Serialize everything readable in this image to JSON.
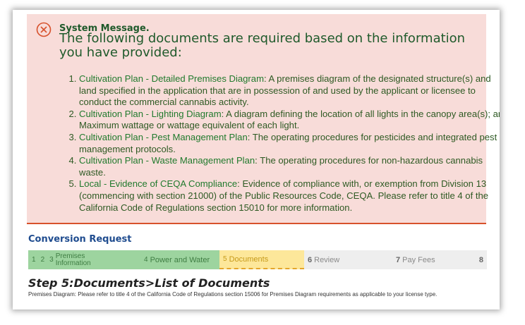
{
  "message": {
    "label": "System Message.",
    "headline": "The following documents are required based on the information you have provided:",
    "documents": [
      {
        "number": "1.",
        "title": "Cultivation Plan - Detailed Premises Diagram",
        "description": ": A premises diagram of the designated structure(s) and land specified in the application that are in possession of and used by the applicant or licensee to conduct the commercial cannabis activity."
      },
      {
        "number": "2.",
        "title": "Cultivation Plan - Lighting Diagram",
        "description": ": A diagram defining the location of all lights in the canopy area(s); and Maximum wattage or wattage equivalent of each light."
      },
      {
        "number": "3.",
        "title": "Cultivation Plan - Pest Management Plan",
        "description": ": The operating procedures for pesticides and integrated pest management protocols."
      },
      {
        "number": "4.",
        "title": "Cultivation Plan - Waste Management Plan",
        "description": ": The operating procedures for non-hazardous cannabis waste."
      },
      {
        "number": "5.",
        "title": "Local - Evidence of CEQA Compliance",
        "description": ": Evidence of compliance with, or exemption from Division 13 (commencing with section 21000) of the Public Resources Code, CEQA. Please refer to title 4 of the California Code of Regulations section 15010 for more information."
      }
    ]
  },
  "request": {
    "title": "Conversion Request",
    "steps": [
      {
        "num": "1",
        "label": ""
      },
      {
        "num": "2",
        "label": ""
      },
      {
        "num": "3",
        "label": "Premises Information"
      },
      {
        "num": "4",
        "label": "Power and Water"
      },
      {
        "num": "5",
        "label": "Documents"
      },
      {
        "num": "6",
        "label": "Review"
      },
      {
        "num": "7",
        "label": "Pay Fees"
      },
      {
        "num": "8",
        "label": ""
      }
    ],
    "step_heading": "Step 5:Documents>List of Documents",
    "note": "Premises Diagram: Please refer to title 4 of the California Code of Regulations section 15006 for Premises Diagram requirements as applicable to your license type."
  },
  "colors": {
    "error": "#d7512c",
    "message_bg": "#f8dcd9",
    "done": "#9dd49f",
    "current": "#fde79a"
  },
  "icons": {
    "message": "error-circle-x-icon"
  }
}
